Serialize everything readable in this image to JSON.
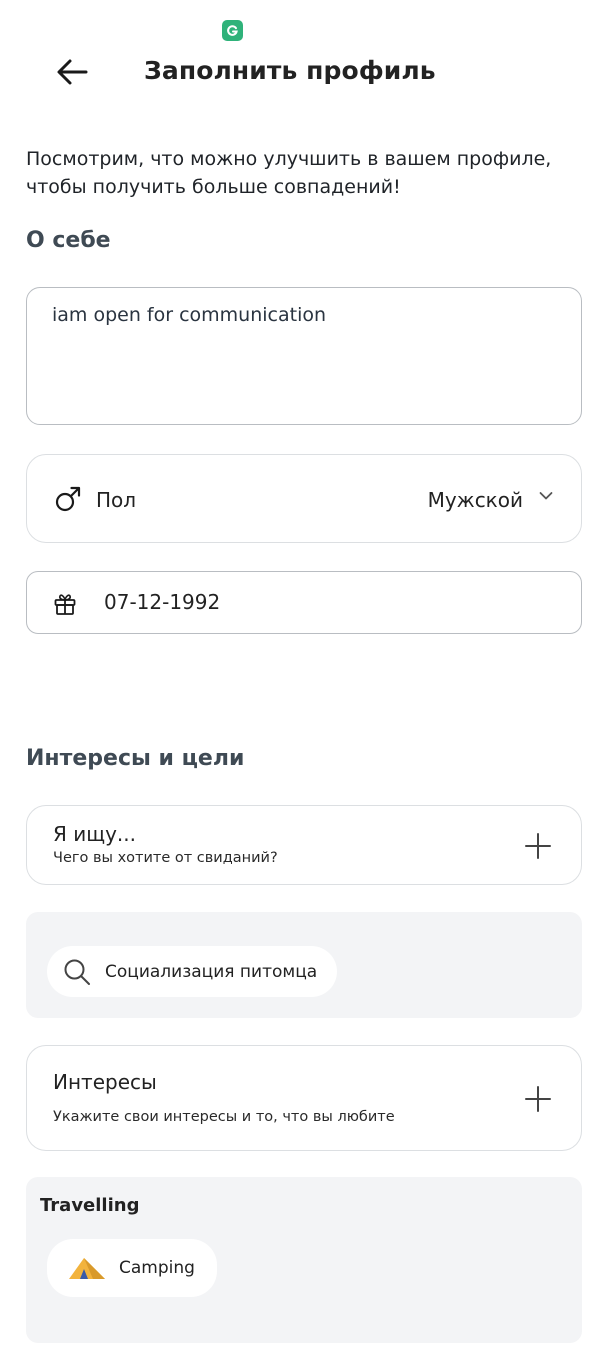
{
  "status_bar": {
    "app_icon": "grammarly-icon",
    "app_icon_color": "#2fb27a"
  },
  "header": {
    "back_icon": "arrow-left-icon",
    "title": "Заполнить профиль"
  },
  "intro_text": "Посмотрим, что можно улучшить в вашем профиле, чтобы получить больше совпадений!",
  "about": {
    "section_title": "О себе",
    "text": "iam open for communication"
  },
  "gender": {
    "icon": "male-icon",
    "label": "Пол",
    "value": "Мужской",
    "dropdown_icon": "chevron-down-icon"
  },
  "birthday": {
    "icon": "gift-icon",
    "value": "07-12-1992"
  },
  "interests_section": {
    "title": "Интересы и цели",
    "looking_for": {
      "title": "Я ищу...",
      "subtitle": "Чего вы хотите от свиданий?",
      "action_icon": "plus-icon"
    },
    "looking_for_chips": [
      {
        "icon": "search-icon",
        "label": "Социализация питомца"
      }
    ],
    "interests": {
      "title": "Интересы",
      "subtitle": "Укажите свои интересы и то, что вы любите",
      "action_icon": "plus-icon"
    },
    "interest_groups": [
      {
        "title": "Travelling",
        "chips": [
          {
            "icon": "tent-icon",
            "label": "Camping"
          }
        ]
      }
    ]
  },
  "colors": {
    "accent": "#2fb27a",
    "panel_bg": "#f3f4f6",
    "border": "#dcdfe2",
    "tent_yellow": "#f2b33d",
    "tent_blue": "#3a5aa8"
  }
}
